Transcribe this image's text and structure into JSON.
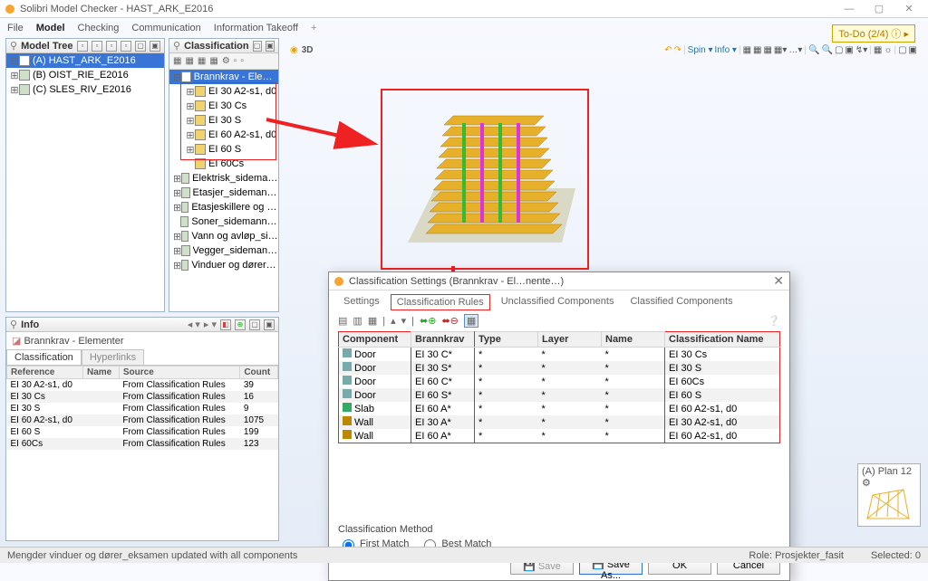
{
  "window": {
    "title": "Solibri Model Checker - HAST_ARK_E2016",
    "min": "—",
    "max": "▢",
    "close": "✕"
  },
  "menu": {
    "file": "File",
    "model": "Model",
    "checking": "Checking",
    "communication": "Communication",
    "info_takeoff": "Information Takeoff"
  },
  "todo": "To-Do (2/4) ⓘ ▸",
  "panels": {
    "model_tree": {
      "title": "Model Tree"
    },
    "classification": {
      "title": "Classification"
    },
    "info": {
      "title": "Info"
    }
  },
  "model_tree_items": [
    {
      "exp": "⊟",
      "label": "(A) HAST_ARK_E2016",
      "sel": true
    },
    {
      "exp": "⊞",
      "label": "(B) OIST_RIE_E2016"
    },
    {
      "exp": "⊞",
      "label": "(C) SLES_RIV_E2016"
    }
  ],
  "classification_items": [
    {
      "exp": "⊟",
      "indent": 0,
      "label": "Brannkrav - Elementer",
      "sel": true
    },
    {
      "exp": "⊞",
      "indent": 1,
      "label": "EI 30 A2-s1, d0",
      "box": true
    },
    {
      "exp": "⊞",
      "indent": 1,
      "label": "EI 30 Cs",
      "box": true
    },
    {
      "exp": "⊞",
      "indent": 1,
      "label": "EI 30 S",
      "box": true
    },
    {
      "exp": "⊞",
      "indent": 1,
      "label": "EI 60 A2-s1, d0",
      "box": true
    },
    {
      "exp": "⊞",
      "indent": 1,
      "label": "EI 60 S",
      "box": true
    },
    {
      "exp": "",
      "indent": 1,
      "label": "EI 60Cs",
      "box": true
    },
    {
      "exp": "⊞",
      "indent": 0,
      "label": "Elektrisk_sidemannskontroll"
    },
    {
      "exp": "⊞",
      "indent": 0,
      "label": "Etasjer_sidemannskontroll"
    },
    {
      "exp": "⊞",
      "indent": 0,
      "label": "Etasjeskillere og tak_sidemanns"
    },
    {
      "exp": "",
      "indent": 0,
      "label": "Soner_sidemannskontroll"
    },
    {
      "exp": "⊞",
      "indent": 0,
      "label": "Vann og avløp_sidemannskontr"
    },
    {
      "exp": "⊞",
      "indent": 0,
      "label": "Vegger_sidemannskontroll"
    },
    {
      "exp": "⊞",
      "indent": 0,
      "label": "Vinduer og dører_sidemannskor"
    }
  ],
  "info": {
    "breadcrumb": "Brannkrav - Elementer",
    "tabs": {
      "class": "Classification",
      "hyper": "Hyperlinks"
    },
    "cols": {
      "ref": "Reference",
      "name": "Name",
      "src": "Source",
      "count": "Count"
    },
    "rows": [
      {
        "ref": "EI 30 A2-s1, d0",
        "src": "From Classification Rules",
        "count": "39"
      },
      {
        "ref": "EI 30 Cs",
        "src": "From Classification Rules",
        "count": "16"
      },
      {
        "ref": "EI 30 S",
        "src": "From Classification Rules",
        "count": "9"
      },
      {
        "ref": "EI 60 A2-s1, d0",
        "src": "From Classification Rules",
        "count": "1075"
      },
      {
        "ref": "EI 60 S",
        "src": "From Classification Rules",
        "count": "199"
      },
      {
        "ref": "EI 60Cs",
        "src": "From Classification Rules",
        "count": "123"
      }
    ]
  },
  "viewport": {
    "label3d": "3D",
    "spin": "Spin ▾",
    "info_btn": "Info ▾"
  },
  "dialog": {
    "title": "Classification Settings (Brannkrav - El…nente…)",
    "tabs": {
      "s": "Settings",
      "r": "Classification Rules",
      "u": "Unclassified Components",
      "c": "Classified Components"
    },
    "cols": {
      "comp": "Component",
      "bk": "Brannkrav",
      "type": "Type",
      "layer": "Layer",
      "name": "Name",
      "cn": "Classification Name"
    },
    "rows": [
      {
        "ico": "door",
        "comp": "Door",
        "bk": "EI 30 C*",
        "type": "*",
        "layer": "*",
        "name": "*",
        "cn": "EI 30 Cs"
      },
      {
        "ico": "door",
        "comp": "Door",
        "bk": "EI 30 S*",
        "type": "*",
        "layer": "*",
        "name": "*",
        "cn": "EI 30 S"
      },
      {
        "ico": "door",
        "comp": "Door",
        "bk": "EI 60 C*",
        "type": "*",
        "layer": "*",
        "name": "*",
        "cn": "EI 60Cs"
      },
      {
        "ico": "door",
        "comp": "Door",
        "bk": "EI 60 S*",
        "type": "*",
        "layer": "*",
        "name": "*",
        "cn": "EI 60 S"
      },
      {
        "ico": "slab",
        "comp": "Slab",
        "bk": "EI 60 A*",
        "type": "*",
        "layer": "*",
        "name": "*",
        "cn": "EI 60 A2-s1, d0"
      },
      {
        "ico": "wall",
        "comp": "Wall",
        "bk": "EI 30 A*",
        "type": "*",
        "layer": "*",
        "name": "*",
        "cn": "EI 30 A2-s1, d0"
      },
      {
        "ico": "wall",
        "comp": "Wall",
        "bk": "EI 60 A*",
        "type": "*",
        "layer": "*",
        "name": "*",
        "cn": "EI 60 A2-s1, d0"
      }
    ],
    "method_label": "Classification Method",
    "first_match": "First Match",
    "best_match": "Best Match",
    "save": "Save",
    "save_as": "Save As...",
    "ok": "OK",
    "cancel": "Cancel"
  },
  "minimap": {
    "label": "(A) Plan 12"
  },
  "status": {
    "left": "Mengder vinduer og dører_eksamen updated with all components",
    "role": "Role: Prosjekter_fasit",
    "sel": "Selected: 0"
  }
}
